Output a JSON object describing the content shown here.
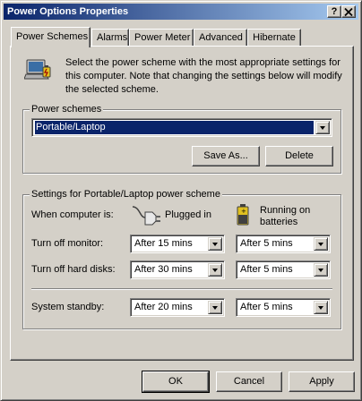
{
  "window": {
    "title": "Power Options Properties",
    "help_button": "?",
    "close_button": "X"
  },
  "tabs": [
    {
      "label": "Power Schemes",
      "active": true
    },
    {
      "label": "Alarms",
      "active": false
    },
    {
      "label": "Power Meter",
      "active": false
    },
    {
      "label": "Advanced",
      "active": false
    },
    {
      "label": "Hibernate",
      "active": false
    }
  ],
  "intro": {
    "text": "Select the power scheme with the most appropriate settings for this computer. Note that changing the settings below will modify the selected scheme."
  },
  "power_schemes": {
    "group_label": "Power schemes",
    "selected": "Portable/Laptop",
    "save_as_label": "Save As...",
    "delete_label": "Delete"
  },
  "settings": {
    "group_label": "Settings for Portable/Laptop power scheme",
    "when_label": "When computer is:",
    "plugged_in_label": "Plugged in",
    "batteries_label": "Running on batteries",
    "rows": [
      {
        "label": "Turn off monitor:",
        "plugged": "After 15 mins",
        "battery": "After 5 mins"
      },
      {
        "label": "Turn off hard disks:",
        "plugged": "After 30 mins",
        "battery": "After 5 mins"
      },
      {
        "label": "System standby:",
        "plugged": "After 20 mins",
        "battery": "After 5 mins"
      }
    ]
  },
  "footer": {
    "ok_label": "OK",
    "cancel_label": "Cancel",
    "apply_label": "Apply"
  },
  "colors": {
    "titlebar_start": "#0a246a",
    "titlebar_end": "#a6caf0",
    "face": "#d4d0c8",
    "selection": "#0a246a"
  },
  "icons": [
    "power-options-icon",
    "power-plug-icon",
    "battery-icon",
    "help-icon",
    "close-icon",
    "dropdown-arrow-icon"
  ]
}
